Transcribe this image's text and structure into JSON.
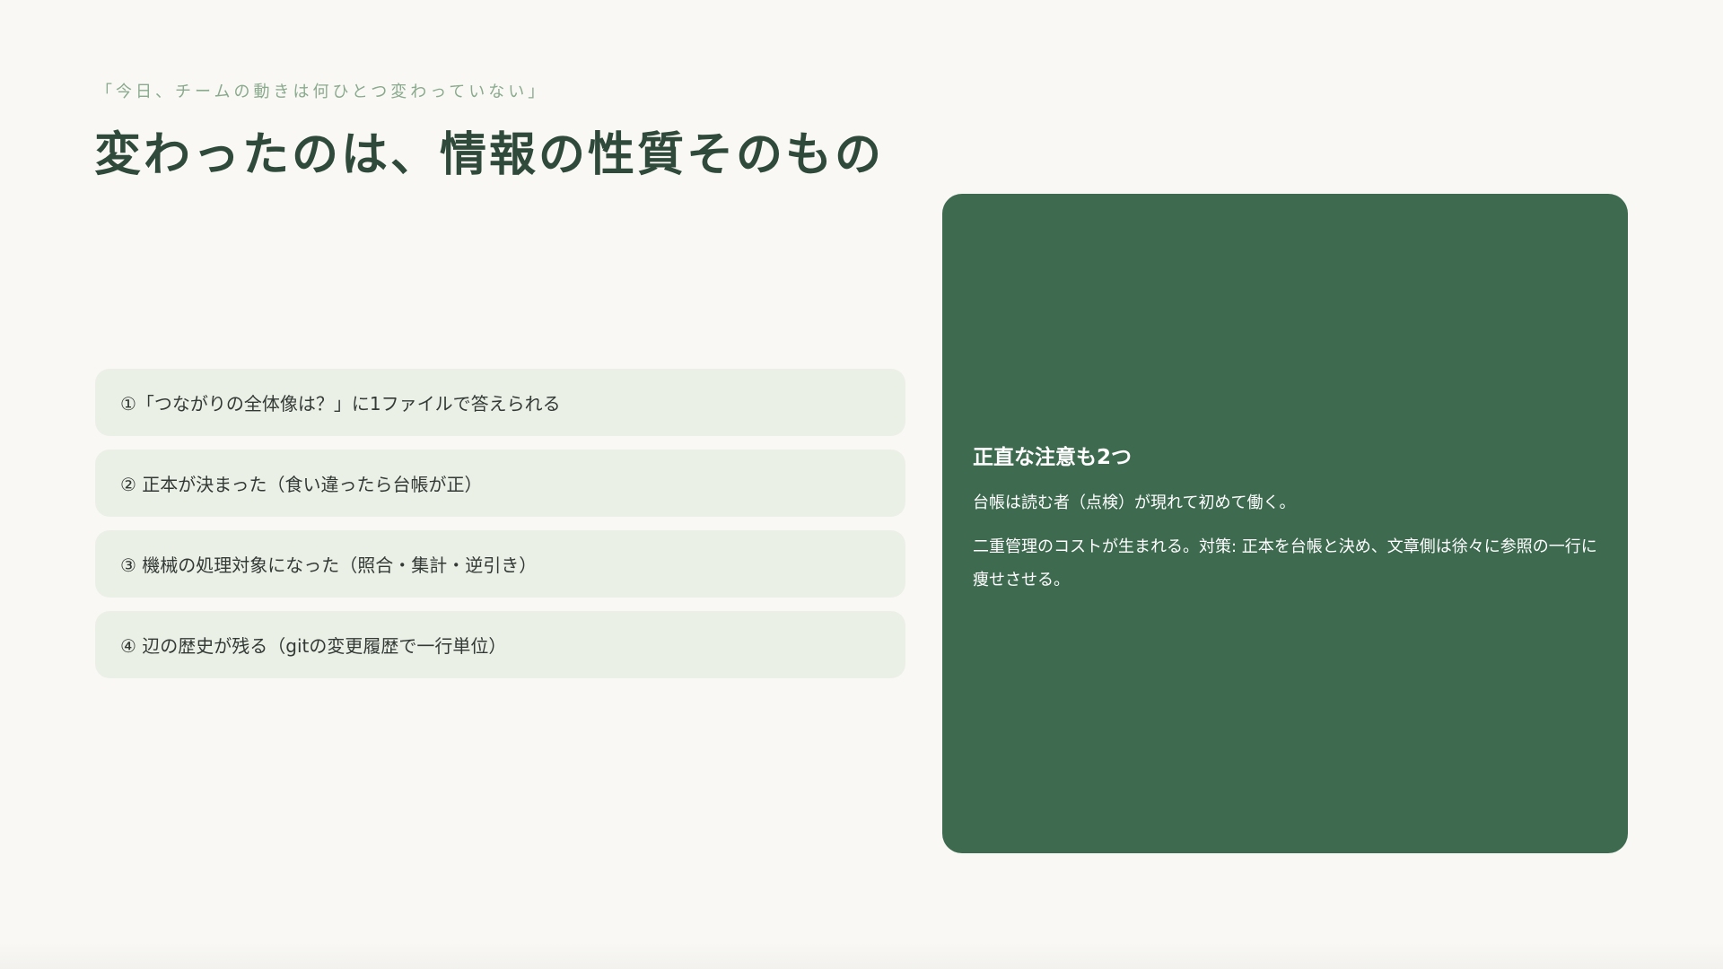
{
  "slide": {
    "eyebrow": "「今日、チームの動きは何ひとつ変わっていない」",
    "title": "変わったのは、情報の性質そのもの",
    "points": [
      "①「つながりの全体像は？」に1ファイルで答えられる",
      "② 正本が決まった（食い違ったら台帳が正）",
      "③ 機械の処理対象になった（照合・集計・逆引き）",
      "④ 辺の歴史が残る（gitの変更履歴で一行単位）"
    ],
    "note": {
      "title": "正直な注意も2つ",
      "lines": [
        "台帳は読む者（点検）が現れて初めて働く。",
        "二重管理のコストが生まれる。対策: 正本を台帳と決め、文章側は徐々に参照の一行に痩せさせる。"
      ]
    }
  },
  "colors": {
    "background": "#f9f8f5",
    "title": "#2f4a3a",
    "eyebrow": "#8aaa8d",
    "point_bg": "#ebf0e6",
    "note_bg": "#3e6b50",
    "note_text": "#ffffff"
  }
}
